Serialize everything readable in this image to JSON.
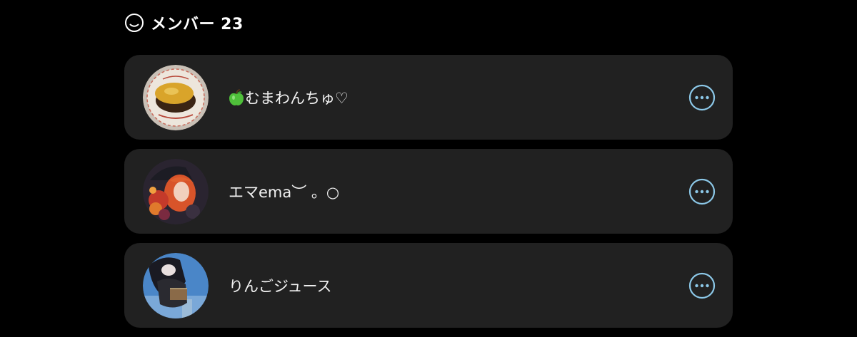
{
  "header": {
    "icon": "smiley-face-icon",
    "title": "メンバー 23"
  },
  "members": [
    {
      "name": "むまわんちゅ♡",
      "prefix_icon": "green-apple-icon",
      "avatar": "omurice-curry-plate-photo",
      "action_icon": "more-options-icon"
    },
    {
      "name": "エマema︶ 。○",
      "avatar": "orange-haired-anime-character-art",
      "action_icon": "more-options-icon"
    },
    {
      "name": "りんごジュース",
      "avatar": "anime-character-in-dark-coat-sky-background",
      "action_icon": "more-options-icon"
    }
  ],
  "colors": {
    "background": "#000000",
    "card": "#212121",
    "text": "#f2f2f2",
    "accent": "#8cc8e8"
  }
}
